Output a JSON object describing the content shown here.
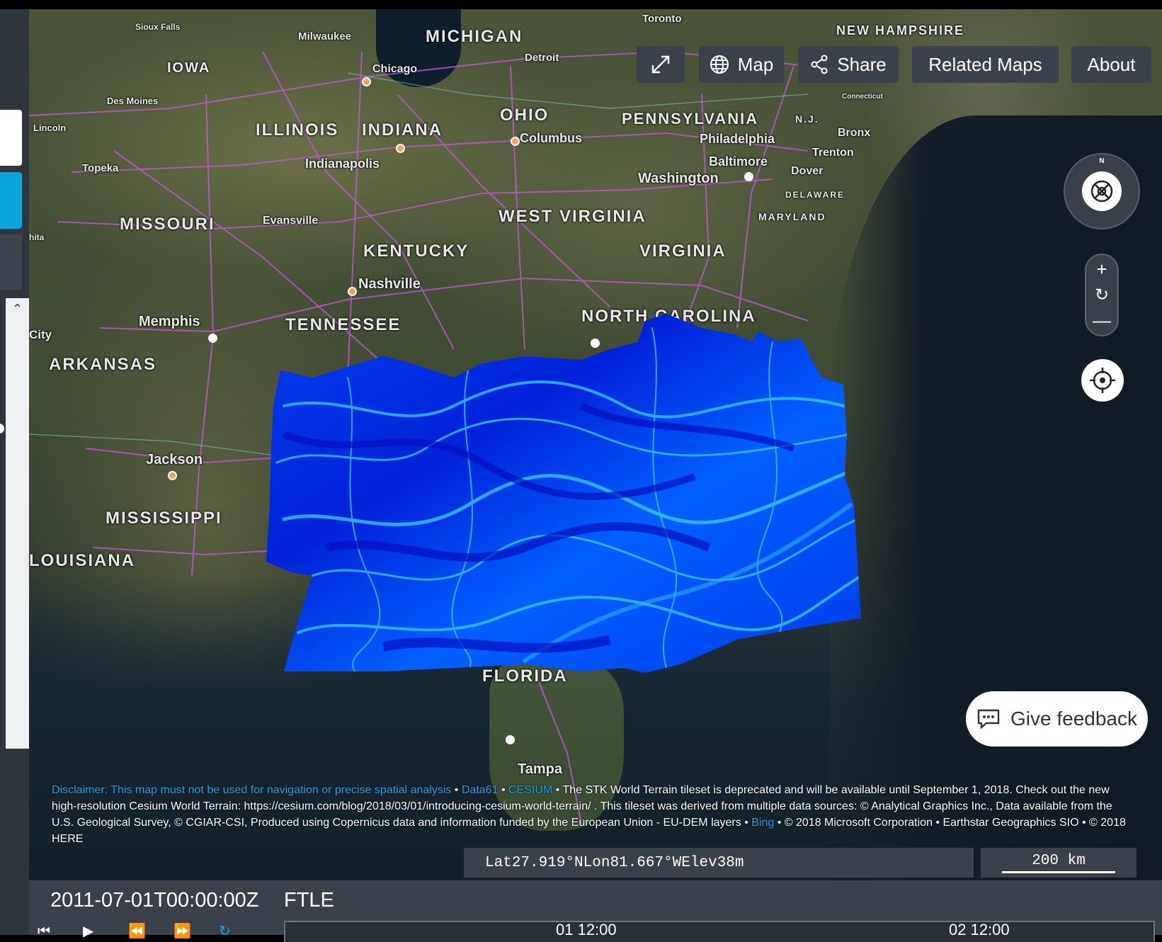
{
  "map": {
    "states": [
      "MICHIGAN",
      "IOWA",
      "ILLINOIS",
      "INDIANA",
      "OHIO",
      "PENNSYLVANIA",
      "MISSOURI",
      "WEST VIRGINIA",
      "KENTUCKY",
      "VIRGINIA",
      "TENNESSEE",
      "NORTH CAROLINA",
      "ARKANSAS",
      "MISSISSIPPI",
      "LOUISIANA",
      "FLORIDA",
      "NEW HAMPSHIRE",
      "DELAWARE",
      "MARYLAND",
      "N.J."
    ],
    "cities": [
      "Sioux Falls",
      "Milwaukee",
      "Chicago",
      "Detroit",
      "Toronto",
      "Des Moines",
      "Lincoln",
      "Topeka",
      "Indianapolis",
      "Columbus",
      "Philadelphia",
      "Bronx",
      "Trenton",
      "Baltimore",
      "Dover",
      "Washington",
      "Evansville",
      "Nashville",
      "Memphis",
      "Jackson",
      "Tampa",
      "City",
      "Connecticut",
      "hita"
    ],
    "overlay_layer": "FTLE"
  },
  "toolbar": {
    "fullscreen_icon": "expand-icon",
    "map_label": "Map",
    "map_icon": "globe-icon",
    "share_label": "Share",
    "share_icon": "share-icon",
    "related_label": "Related Maps",
    "about_label": "About"
  },
  "navigation": {
    "compass_north": "N",
    "zoom_in_icon": "plus-icon",
    "zoom_reset_icon": "refresh-icon",
    "zoom_out_icon": "minus-icon",
    "locate_icon": "crosshair-icon"
  },
  "feedback": {
    "label": "Give feedback",
    "icon": "chat-icon"
  },
  "credits": {
    "disclaimer": "Disclaimer: This map must not be used for navigation or precise spatial analysis",
    "sep1": " • ",
    "data61": "Data61",
    "sep2": " • ",
    "cesium": "CESIUM",
    "text1": " • The STK World Terrain tileset is deprecated and will be available until September 1, 2018. Check out the new high-resolution Cesium World Terrain: https://cesium.com/blog/2018/03/01/introducing-cesium-world-terrain/ . This tileset was derived from multiple data sources: © Analytical Graphics Inc., Data available from the U.S. Geological Survey, © CGIAR-CSI, Produced using Copernicus data and information funded by the European Union - EU-DEM layers • ",
    "bing": "Bing",
    "text2": " • © 2018 Microsoft Corporation • Earthstar Geographics SIO • © 2018 HERE"
  },
  "location": {
    "lat_label": "Lat",
    "lat": "27.919°N",
    "lon_label": "Lon",
    "lon": "81.667°W",
    "elev_label": "Elev",
    "elev": "38m"
  },
  "scale": {
    "label": "200 km"
  },
  "timeline": {
    "current_time": "2011-07-01T00:00:00Z",
    "layer": "FTLE",
    "tick1": "01 12:00",
    "tick2": "02 12:00",
    "buttons": [
      "skip-back-icon",
      "play-icon",
      "rewind-icon",
      "fast-forward-icon",
      "loop-icon"
    ]
  },
  "colors": {
    "ftle_low": "#0010d0",
    "ftle_mid": "#0050ff",
    "ftle_high": "#30c8ff",
    "panel": "#3a414a",
    "accent": "#1ba6e0"
  }
}
